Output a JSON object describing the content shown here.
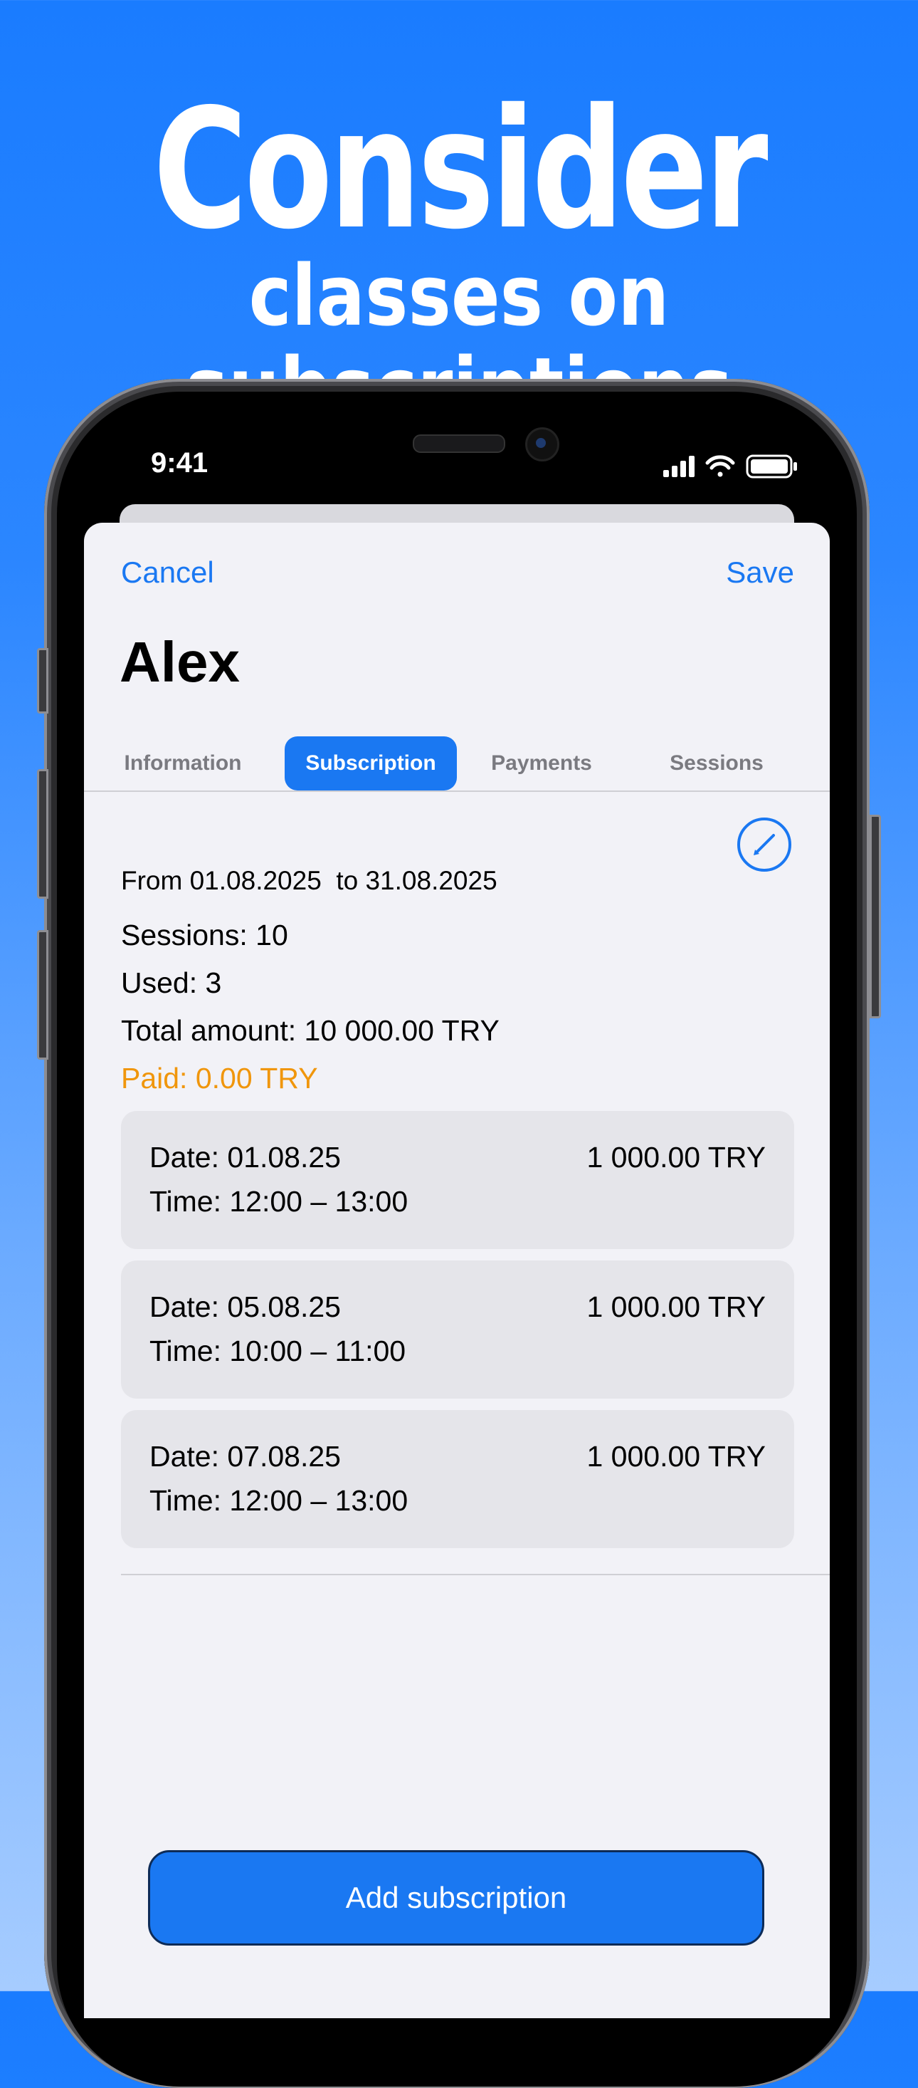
{
  "promo": {
    "headline": "Consider",
    "subheadline": "classes on subscriptions"
  },
  "status_bar": {
    "time": "9:41",
    "icons": [
      "cellular-signal-icon",
      "wifi-icon",
      "battery-icon"
    ]
  },
  "nav": {
    "cancel_label": "Cancel",
    "save_label": "Save"
  },
  "client": {
    "name": "Alex"
  },
  "tabs": [
    {
      "label": "Information",
      "active": false
    },
    {
      "label": "Subscription",
      "active": true
    },
    {
      "label": "Payments",
      "active": false
    },
    {
      "label": "Sessions",
      "active": false
    }
  ],
  "subscription": {
    "period": "From 01.08.2025  to 31.08.2025",
    "sessions": "Sessions: 10",
    "used": "Used: 3",
    "total_amount": "Total amount: 10 000.00 TRY",
    "paid": "Paid: 0.00 TRY",
    "edit_icon": "pencil-icon"
  },
  "sessions_list": [
    {
      "date": "Date: 01.08.25",
      "time": "Time: 12:00 – 13:00",
      "amount": "1 000.00 TRY"
    },
    {
      "date": "Date: 05.08.25",
      "time": "Time: 10:00 – 11:00",
      "amount": "1 000.00 TRY"
    },
    {
      "date": "Date: 07.08.25",
      "time": "Time: 12:00 – 13:00",
      "amount": "1 000.00 TRY"
    }
  ],
  "actions": {
    "add_subscription_label": "Add subscription"
  },
  "colors": {
    "accent": "#1a78f2",
    "paid_warning": "#f0960c",
    "background_top": "#1a7cff",
    "background_bottom": "#a6ccff",
    "sheet_background": "#f2f2f7",
    "card_background": "#e5e5ea"
  }
}
